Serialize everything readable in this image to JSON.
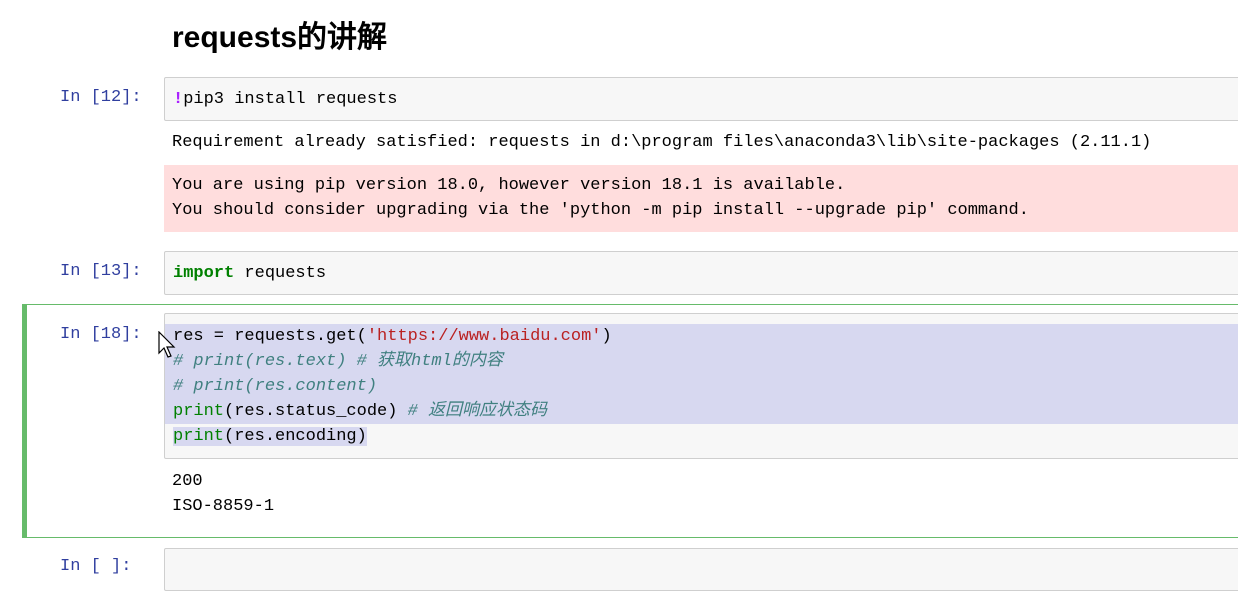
{
  "heading": "requests的讲解",
  "cells": [
    {
      "prompt": "In  [12]:",
      "code": {
        "bang": "!",
        "rest": "pip3 install requests"
      },
      "stdout": "Requirement already satisfied: requests in d:\\program files\\anaconda3\\lib\\site-packages (2.11.1)",
      "stderr": [
        "You are using pip version 18.0, however version 18.1 is available.",
        "You should consider upgrading via the 'python -m pip install --upgrade pip' command."
      ]
    },
    {
      "prompt": "In  [13]:",
      "code": {
        "kw": "import",
        "rest": " requests"
      }
    },
    {
      "prompt": "In  [18]:",
      "selected": true,
      "code": {
        "l1a": "res = requests.get(",
        "l1s": "'https://www.baidu.com'",
        "l1b": ")",
        "l2": "# print(res.text) # 获取html的内容",
        "l3": "# print(res.content)",
        "l4p": "print",
        "l4a": "(res.status_code) ",
        "l4c": "# 返回响应状态码",
        "l5p": "print",
        "l5a": "(res.encoding)"
      },
      "output": [
        "200",
        "ISO-8859-1"
      ]
    },
    {
      "prompt": "In  [ ]:",
      "code": ""
    }
  ],
  "colors": {
    "prompt": "#303f9f",
    "selected_border": "#66bb6a",
    "stderr_bg": "#ffdddd",
    "selection": "#d7d8f0"
  }
}
